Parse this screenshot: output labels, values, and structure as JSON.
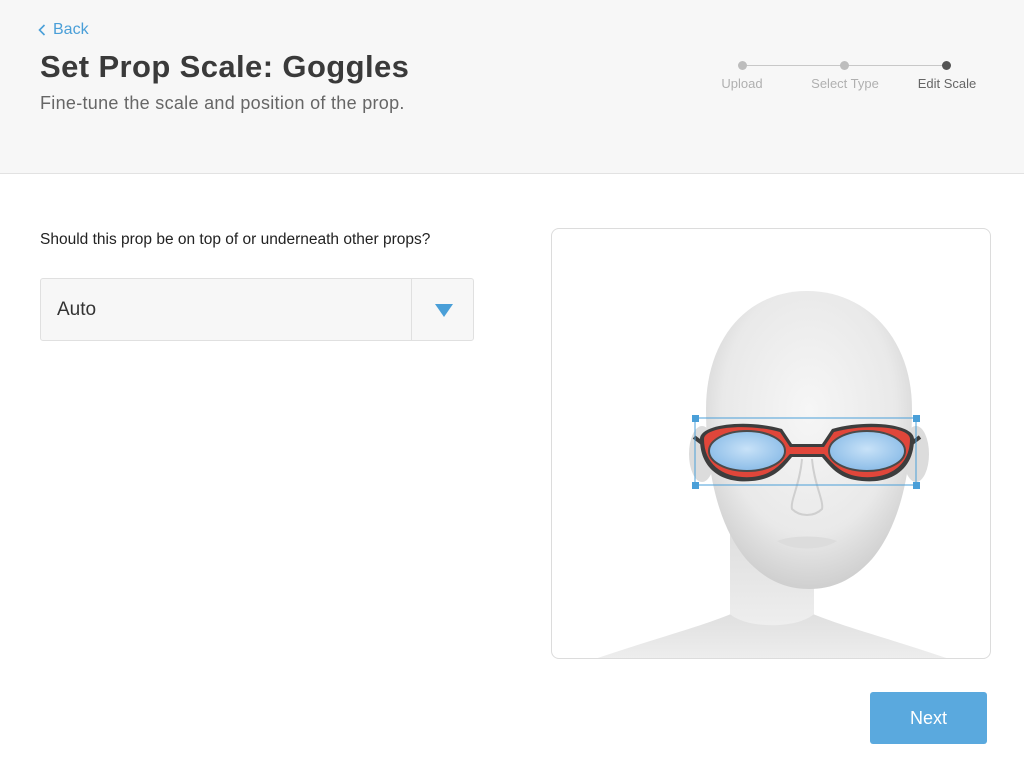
{
  "header": {
    "back_label": "Back",
    "title": "Set Prop Scale: Goggles",
    "subtitle": "Fine-tune the scale and position of the prop."
  },
  "stepper": {
    "steps": [
      {
        "label": "Upload",
        "active": false
      },
      {
        "label": "Select Type",
        "active": false
      },
      {
        "label": "Edit Scale",
        "active": true
      }
    ]
  },
  "form": {
    "question": "Should this prop be on top of or underneath other props?",
    "layer_select": {
      "value": "Auto"
    }
  },
  "preview": {
    "prop_name": "Goggles",
    "icons": [
      "mannequin-head",
      "goggles",
      "resize-handle"
    ]
  },
  "footer": {
    "next_label": "Next"
  },
  "colors": {
    "accent": "#4a9fd8",
    "button": "#5aa9de",
    "goggle_frame": "#e0463a",
    "goggle_lens": "#9ac9f0"
  }
}
